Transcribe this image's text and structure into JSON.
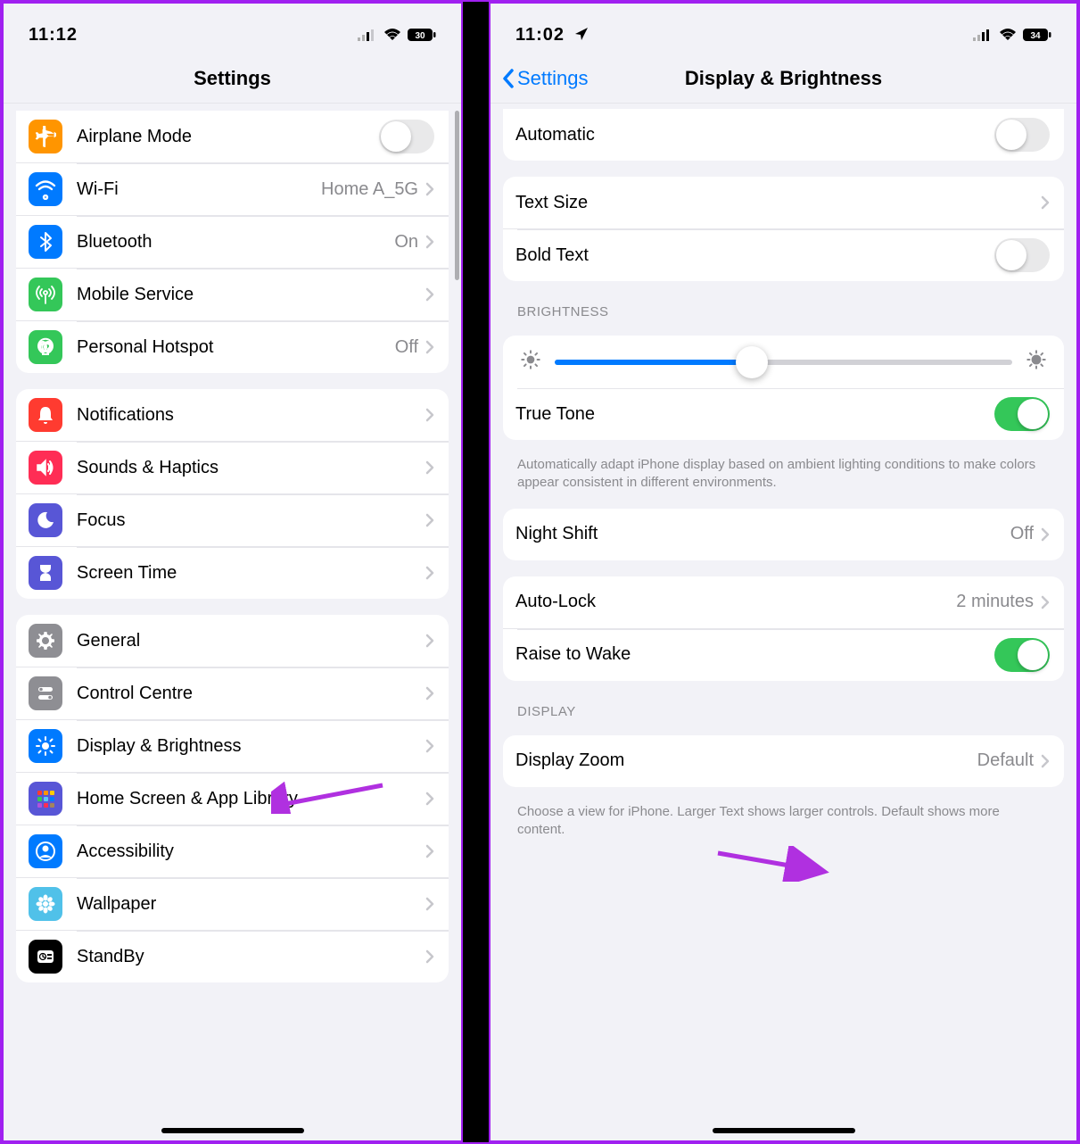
{
  "left": {
    "status": {
      "time": "11:12",
      "battery": "30"
    },
    "title": "Settings",
    "groups": [
      {
        "rows": [
          {
            "icon": "airplane",
            "color": "#ff9500",
            "label": "Airplane Mode",
            "switch": false
          },
          {
            "icon": "wifi",
            "color": "#007aff",
            "label": "Wi-Fi",
            "value": "Home A_5G",
            "chev": true
          },
          {
            "icon": "bluetooth",
            "color": "#007aff",
            "label": "Bluetooth",
            "value": "On",
            "chev": true
          },
          {
            "icon": "antenna",
            "color": "#34c759",
            "label": "Mobile Service",
            "chev": true
          },
          {
            "icon": "hotspot",
            "color": "#34c759",
            "label": "Personal Hotspot",
            "value": "Off",
            "chev": true
          }
        ]
      },
      {
        "rows": [
          {
            "icon": "bell",
            "color": "#ff3b30",
            "label": "Notifications",
            "chev": true
          },
          {
            "icon": "speaker",
            "color": "#ff2d55",
            "label": "Sounds & Haptics",
            "chev": true
          },
          {
            "icon": "moon",
            "color": "#5856d6",
            "label": "Focus",
            "chev": true
          },
          {
            "icon": "hourglass",
            "color": "#5856d6",
            "label": "Screen Time",
            "chev": true
          }
        ]
      },
      {
        "rows": [
          {
            "icon": "gear",
            "color": "#8e8e93",
            "label": "General",
            "chev": true
          },
          {
            "icon": "switches",
            "color": "#8e8e93",
            "label": "Control Centre",
            "chev": true
          },
          {
            "icon": "sun",
            "color": "#007aff",
            "label": "Display & Brightness",
            "chev": true
          },
          {
            "icon": "grid",
            "color": "#5856d6",
            "label": "Home Screen & App Library",
            "chev": true
          },
          {
            "icon": "person",
            "color": "#007aff",
            "label": "Accessibility",
            "chev": true
          },
          {
            "icon": "flower",
            "color": "#50c1e9",
            "label": "Wallpaper",
            "chev": true
          },
          {
            "icon": "clock",
            "color": "#000000",
            "label": "StandBy",
            "chev": true
          }
        ]
      }
    ]
  },
  "right": {
    "status": {
      "time": "11:02",
      "battery": "34",
      "location": true
    },
    "back": "Settings",
    "title": "Display & Brightness",
    "sections": [
      {
        "type": "group",
        "rows": [
          {
            "label": "Automatic",
            "switch": false
          }
        ]
      },
      {
        "type": "group",
        "rows": [
          {
            "label": "Text Size",
            "chev": true
          },
          {
            "label": "Bold Text",
            "switch": false
          }
        ]
      },
      {
        "type": "header",
        "text": "BRIGHTNESS"
      },
      {
        "type": "group",
        "rows": [
          {
            "slider": 43
          },
          {
            "label": "True Tone",
            "switch": true
          }
        ]
      },
      {
        "type": "footer",
        "text": "Automatically adapt iPhone display based on ambient lighting conditions to make colors appear consistent in different environments."
      },
      {
        "type": "group",
        "rows": [
          {
            "label": "Night Shift",
            "value": "Off",
            "chev": true
          }
        ]
      },
      {
        "type": "group",
        "rows": [
          {
            "label": "Auto-Lock",
            "value": "2 minutes",
            "chev": true
          },
          {
            "label": "Raise to Wake",
            "switch": true
          }
        ]
      },
      {
        "type": "header",
        "text": "DISPLAY"
      },
      {
        "type": "group",
        "rows": [
          {
            "label": "Display Zoom",
            "value": "Default",
            "chev": true
          }
        ]
      },
      {
        "type": "footer",
        "text": "Choose a view for iPhone. Larger Text shows larger controls. Default shows more content."
      }
    ]
  }
}
